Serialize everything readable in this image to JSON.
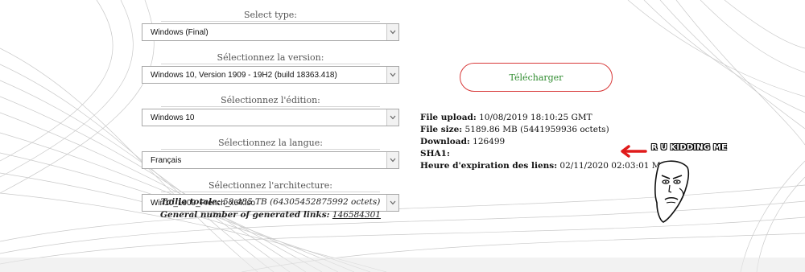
{
  "form": {
    "type": {
      "label": "Select type:",
      "value": "Windows (Final)"
    },
    "version": {
      "label": "Sélectionnez la version:",
      "value": "Windows 10, Version 1909 - 19H2 (build 18363.418)"
    },
    "edition": {
      "label": "Sélectionnez l'édition:",
      "value": "Windows 10"
    },
    "language": {
      "label": "Sélectionnez la langue:",
      "value": "Français"
    },
    "architecture": {
      "label": "Sélectionnez l'architecture:",
      "value": "Win10_1909_French_x64.iso"
    }
  },
  "totals": {
    "size_label": "Taille totale:",
    "size_value": "58.485 TB (64305452875992 octets)",
    "links_label": "General number of generated links:",
    "links_value": "146584301"
  },
  "download_button": "Télécharger",
  "file_info": {
    "upload_label": "File upload:",
    "upload_value": "10/08/2019 18:10:25 GMT",
    "size_label": "File size:",
    "size_value": "5189.86 MB (5441959936 octets)",
    "download_label": "Download:",
    "download_value": "126499",
    "sha1_label": "SHA1:",
    "sha1_value": "",
    "expiry_label": "Heure d'expiration des liens:",
    "expiry_value": "02/11/2020 02:03:01 MSK"
  },
  "meme": {
    "caption": "R U KIDDING ME",
    "icon": "meme-face-icon"
  },
  "annotation": {
    "icon": "red-arrow-icon",
    "color": "#e01b1b"
  },
  "colors": {
    "button_border": "#d83a3a",
    "button_text": "#2e8b2e"
  }
}
